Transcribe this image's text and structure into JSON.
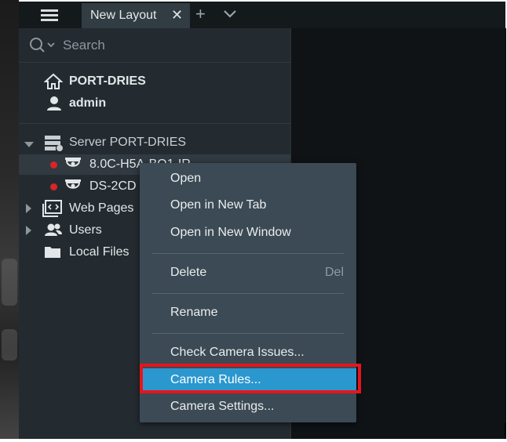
{
  "toolbar": {
    "menu_icon": "hamburger-icon",
    "tab_label": "New Layout",
    "tab_close": "✕",
    "add_tab": "+",
    "more_tabs_icon": "chevron-down-icon"
  },
  "search": {
    "placeholder": "Search",
    "icon": "search-icon"
  },
  "user_info": {
    "system_name": "PORT-DRIES",
    "user_name": "admin"
  },
  "tree": {
    "server_label": "Server PORT-DRIES",
    "cameras": [
      {
        "label": "8.0C-H5A-BO1-IR",
        "status_color": "#d9242a"
      },
      {
        "label": "DS-2CD",
        "status_color": "#d9242a"
      }
    ],
    "web_pages_label": "Web Pages",
    "users_label": "Users",
    "local_files_label": "Local Files"
  },
  "context_menu": {
    "items": [
      {
        "label": "Open",
        "shortcut": ""
      },
      {
        "label": "Open in New Tab",
        "shortcut": ""
      },
      {
        "label": "Open in New Window",
        "shortcut": ""
      },
      {
        "label": "Delete",
        "shortcut": "Del"
      },
      {
        "label": "Rename",
        "shortcut": ""
      },
      {
        "label": "Check Camera Issues...",
        "shortcut": ""
      },
      {
        "label": "Camera Rules...",
        "shortcut": ""
      },
      {
        "label": "Camera Settings...",
        "shortcut": ""
      }
    ],
    "highlighted_index": 6
  },
  "colors": {
    "accent": "#2b97cf",
    "annotation_box": "#e8141c",
    "status_dot": "#d9242a"
  }
}
